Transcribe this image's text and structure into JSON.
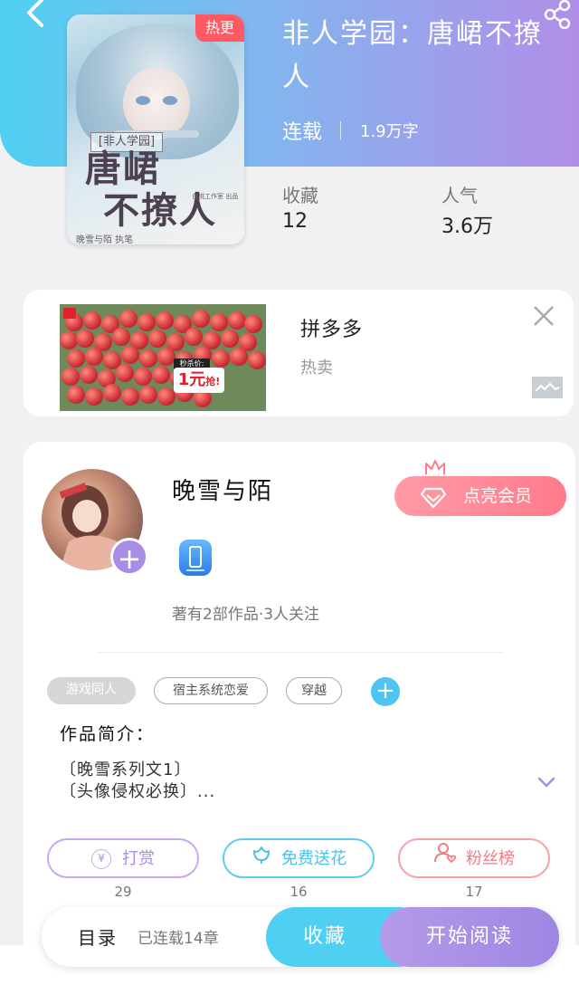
{
  "header": {
    "book_title": "非人学园：唐峮不撩人",
    "status": "连载",
    "word_count": "1.9万字",
    "collect_label": "收藏",
    "collect_value": "12",
    "popularity_label": "人气",
    "popularity_value": "3.6万",
    "gradient_start": "#4fd0f2",
    "gradient_end": "#b18ee8"
  },
  "cover": {
    "tag": "热更",
    "series": "[非人学园]",
    "title_line1": "唐峮",
    "title_line2": "不撩人",
    "author": "晚雪与陌 执笔",
    "publisher": "白桃工作室 出品"
  },
  "ad": {
    "title": "拼多多",
    "subtitle": "热卖",
    "price_label": "秒杀价:",
    "price": "1元",
    "grab": "抢!"
  },
  "author": {
    "name": "晚雪与陌",
    "stats": "著有2部作品·3人关注",
    "vip_button": "点亮会员",
    "vip_color": "#ff7a8a"
  },
  "tags": [
    "游戏同人",
    "宿主系统恋爱",
    "穿越"
  ],
  "intro": {
    "label": "作品简介：",
    "line1": "〔晚雪系列文1〕",
    "line2": "〔头像侵权必换〕..."
  },
  "actions": {
    "reward_label": "打赏",
    "reward_count": "29",
    "flower_label": "免费送花",
    "flower_count": "16",
    "fans_label": "粉丝榜",
    "fans_count": "17"
  },
  "bottom_bar": {
    "toc_label": "目录",
    "chapters": "已连载14章",
    "collect_button": "收藏",
    "read_button": "开始阅读"
  }
}
